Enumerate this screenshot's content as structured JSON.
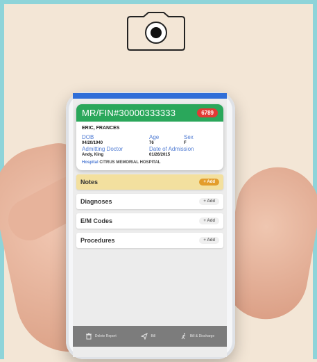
{
  "camera": {
    "icon": "camera-icon"
  },
  "patient": {
    "mrn": "MR/FIN#30000333333",
    "badge": "6789",
    "name": "ERIC, FRANCES",
    "labels": {
      "dob": "DOB",
      "age": "Age",
      "sex": "Sex",
      "admitting_doctor": "Admitting Doctor",
      "date_of_admission": "Date of Admission",
      "hospital": "Hospital"
    },
    "dob": "04/20/1940",
    "age": "76",
    "sex": "F",
    "admitting_doctor": "Andy, King",
    "date_of_admission": "01/26/2015",
    "hospital": "CITRUS MEMORIAL HOSPITAL"
  },
  "sections": [
    {
      "label": "Notes",
      "button": "+ Add"
    },
    {
      "label": "Diagnoses",
      "button": "+ Add"
    },
    {
      "label": "E/M Codes",
      "button": "+ Add"
    },
    {
      "label": "Procedures",
      "button": "+ Add"
    }
  ],
  "bottom_actions": [
    {
      "label": "Delete Report",
      "icon": "trash-icon"
    },
    {
      "label": "Bill",
      "icon": "send-icon"
    },
    {
      "label": "Bill & Discharge",
      "icon": "walking-person-icon"
    }
  ]
}
